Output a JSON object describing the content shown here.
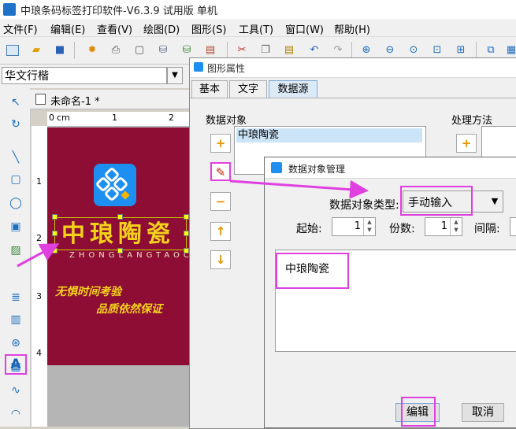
{
  "window": {
    "title": "中琅条码标签打印软件-V6.3.9 试用版 单机"
  },
  "menubar": {
    "items": [
      "文件(F)",
      "编辑(E)",
      "查看(V)",
      "绘图(D)",
      "图形(S)",
      "工具(T)",
      "窗口(W)",
      "帮助(H)"
    ]
  },
  "fontbar": {
    "font_name": "华文行楷"
  },
  "document": {
    "tab_label": "未命名-1 *",
    "ruler_h": [
      "0",
      "cm",
      "1",
      "2"
    ],
    "ruler_v": [
      "1",
      "2",
      "3",
      "4"
    ]
  },
  "label": {
    "brand": "中琅陶瓷",
    "pinyin": "ZHONGLANGTAOCI",
    "slogan1": "无惧时间考验",
    "slogan2": "品质依然保证"
  },
  "properties_dialog": {
    "title": "图形属性",
    "tabs": [
      "基本",
      "文字",
      "数据源"
    ],
    "data_object_label": "数据对象",
    "process_label": "处理方法",
    "data_object_item": "中琅陶瓷"
  },
  "manager_dialog": {
    "title": "数据对象管理",
    "type_label": "数据对象类型:",
    "type_value": "手动输入",
    "start_label": "起始:",
    "start_value": "1",
    "copies_label": "份数:",
    "copies_value": "1",
    "interval_label": "间隔:",
    "content": "中琅陶瓷",
    "edit_button": "编辑",
    "cancel_button": "取消"
  },
  "colors": {
    "label_background": "#8d0d34",
    "label_text": "#f4d21a",
    "highlight": "#e040e0"
  }
}
